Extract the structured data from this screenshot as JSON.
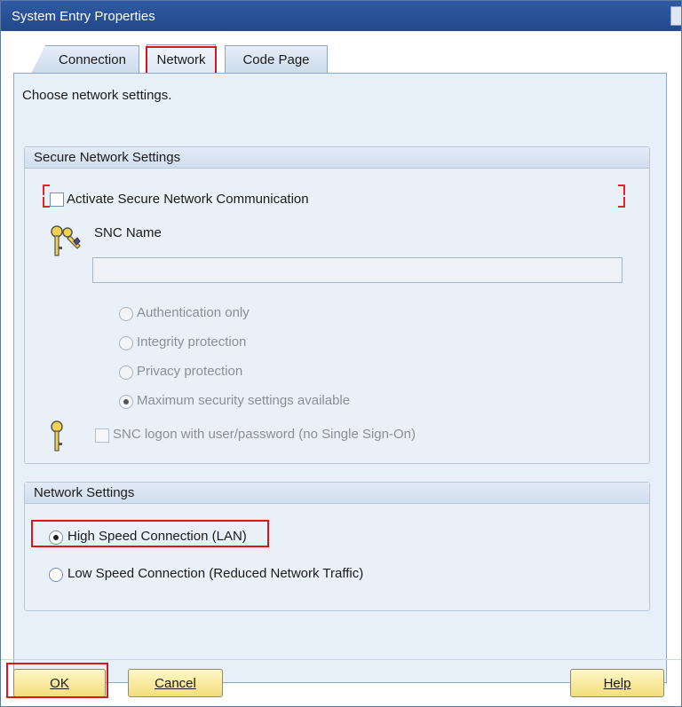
{
  "window": {
    "title": "System Entry Properties"
  },
  "tabs": [
    {
      "label": "Connection"
    },
    {
      "label": "Network"
    },
    {
      "label": "Code Page"
    }
  ],
  "description": "Choose network settings.",
  "secure": {
    "header": "Secure Network Settings",
    "activate_label": "Activate Secure Network Communication",
    "snc_name_label": "SNC Name",
    "snc_name_value": "",
    "options": [
      {
        "label": "Authentication only"
      },
      {
        "label": "Integrity protection"
      },
      {
        "label": "Privacy protection"
      },
      {
        "label": "Maximum security settings available"
      }
    ],
    "logon_label": "SNC logon with user/password (no Single Sign-On)"
  },
  "network": {
    "header": "Network Settings",
    "options": [
      {
        "label": "High Speed Connection (LAN)"
      },
      {
        "label": "Low Speed Connection (Reduced Network Traffic)"
      }
    ]
  },
  "buttons": {
    "ok": "OK",
    "cancel": "Cancel",
    "help": "Help"
  },
  "colors": {
    "highlight": "#d7161e",
    "titlebar": "#2f5aa3",
    "button": "#f3de7a"
  }
}
